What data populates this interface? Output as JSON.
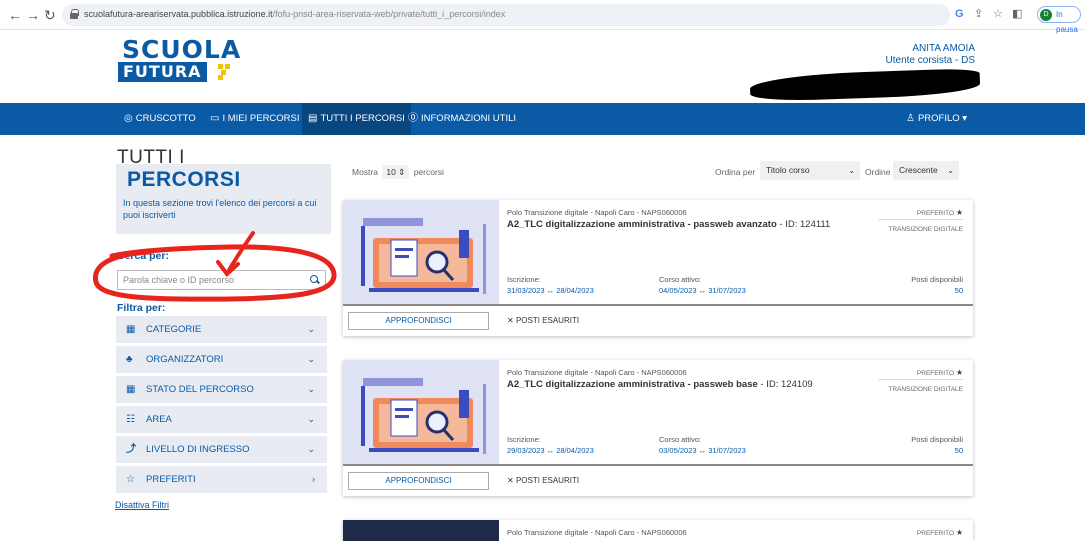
{
  "browser": {
    "url_host": "scuolafutura-areariservata.pubblica.istruzione.it",
    "url_path": "/fofu-pnsd-area-riservata-web/private/tutti_i_percorsi/index",
    "pause_label": "In pausa",
    "profile_initial": "D"
  },
  "header": {
    "logo_top": "SCUOLA",
    "logo_bottom": "FUTURA",
    "user_name": "ANITA AMOIA",
    "user_role": "Utente corsista - DS"
  },
  "nav": {
    "cruscotto": "CRUSCOTTO",
    "miei_percorsi": "I MIEI PERCORSI",
    "tutti_percorsi": "TUTTI I PERCORSI",
    "info_utili": "INFORMAZIONI UTILI",
    "profilo": "PROFILO"
  },
  "sidebar": {
    "title_line1": "TUTTI I",
    "title_line2": "PERCORSI",
    "intro": "In questa sezione trovi l'elenco dei percorsi a cui puoi iscriverti",
    "cerca_label": "Cerca per:",
    "search_placeholder": "Parola chiave o ID percorso",
    "filtra_label": "Filtra per:",
    "filters": [
      {
        "label": "CATEGORIE",
        "icon": "grid-icon"
      },
      {
        "label": "ORGANIZZATORI",
        "icon": "users-icon"
      },
      {
        "label": "STATO DEL PERCORSO",
        "icon": "grid-icon"
      },
      {
        "label": "AREA",
        "icon": "list-icon"
      },
      {
        "label": "LIVELLO DI INGRESSO",
        "icon": "level-icon"
      },
      {
        "label": "PREFERITI",
        "icon": "star-icon"
      }
    ],
    "disattiva": "Disattiva Filtri"
  },
  "toolbar": {
    "mostra": "Mostra",
    "mostra_value": "10",
    "percorsi": "percorsi",
    "ordina_label": "Ordina per",
    "ordina_value": "Titolo corso",
    "ordine_label": "Ordine",
    "ordine_value": "Crescente"
  },
  "cards": [
    {
      "org": "Polo Transizione digitale - Napoli Caro - NAPS060006",
      "title_bold": "A2_TLC digitalizzazione amministrativa - passweb avanzato",
      "title_id": " - ID: 124111",
      "pref": "PREFERITO",
      "tag": "TRANSIZIONE DIGITALE",
      "iscrizione_label": "Iscrizione:",
      "iscrizione": "31/03/2023 ↔ 28/04/2023",
      "corso_label": "Corso attivo:",
      "corso": "04/05/2023 ↔ 31/07/2023",
      "posti_label": "Posti disponibili",
      "posti": "50",
      "approf": "APPROFONDISCI",
      "esauriti": "POSTI ESAURITI"
    },
    {
      "org": "Polo Transizione digitale - Napoli Caro - NAPS060006",
      "title_bold": "A2_TLC digitalizzazione amministrativa - passweb base",
      "title_id": " - ID: 124109",
      "pref": "PREFERITO",
      "tag": "TRANSIZIONE DIGITALE",
      "iscrizione_label": "Iscrizione:",
      "iscrizione": "29/03/2023 ↔ 28/04/2023",
      "corso_label": "Corso attivo:",
      "corso": "03/05/2023 ↔ 31/07/2023",
      "posti_label": "Posti disponibili",
      "posti": "50",
      "approf": "APPROFONDISCI",
      "esauriti": "POSTI ESAURITI"
    },
    {
      "org": "Polo Transizione digitale - Napoli Caro - NAPS060006",
      "pref": "PREFERITO"
    }
  ]
}
